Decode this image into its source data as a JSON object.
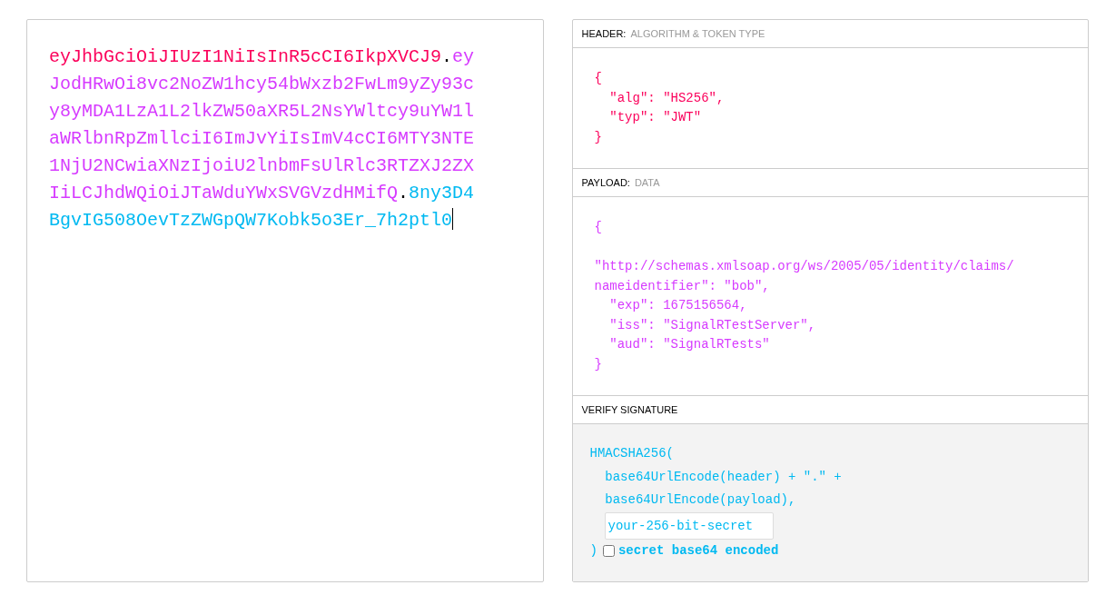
{
  "encoded": {
    "parts": [
      {
        "kind": "header",
        "text": "eyJhbGciOiJIUzI1NiIsInR5cCI6IkpXVCJ9"
      },
      {
        "kind": "dot",
        "text": "."
      },
      {
        "kind": "payload",
        "text": "eyJodHRwOi8vc2NoZW1hcy54bWxzb2FwLm9yZy93cy8yMDA1LzA1L2lkZW50aXR5L2NsYWltcy9uYW1laWRlbnRpZmllciI6ImJvYiIsImV4cCI6MTY3NTE1NjU2NCwiaXNzIjoiU2lnbmFsUlRlc3RTZXJ2ZXIiLCJhdWQiOiJTaWduYWxSVGVzdHMifQ"
      },
      {
        "kind": "dot",
        "text": "."
      },
      {
        "kind": "signature",
        "text": "8ny3D4BgvIG508OevTzZWGpQW7Kobk5o3Er_7h2ptl0"
      }
    ],
    "cursor": true
  },
  "sections": [
    {
      "kind": "header",
      "title": "HEADER:",
      "subtitle": "ALGORITHM & TOKEN TYPE",
      "lines": [
        "{",
        "  \"alg\": \"HS256\",",
        "  \"typ\": \"JWT\"",
        "}"
      ]
    },
    {
      "kind": "payload",
      "title": "PAYLOAD:",
      "subtitle": "DATA",
      "blank_line_after_brace": true,
      "lines": [
        "{",
        "\"http://schemas.xmlsoap.org/ws/2005/05/identity/claims/",
        "nameidentifier\": \"bob\",",
        "  \"exp\": 1675156564,",
        "  \"iss\": \"SignalRTestServer\",",
        "  \"aud\": \"SignalRTests\"",
        "}"
      ]
    },
    {
      "kind": "signature",
      "title": "VERIFY SIGNATURE",
      "lines": [
        "HMACSHA256(",
        "  base64UrlEncode(header) + \".\" +",
        "  base64UrlEncode(payload),"
      ],
      "secret": "your-256-bit-secret",
      "close": ")",
      "base64_label": "secret base64 encoded",
      "base64_checked": false
    }
  ]
}
